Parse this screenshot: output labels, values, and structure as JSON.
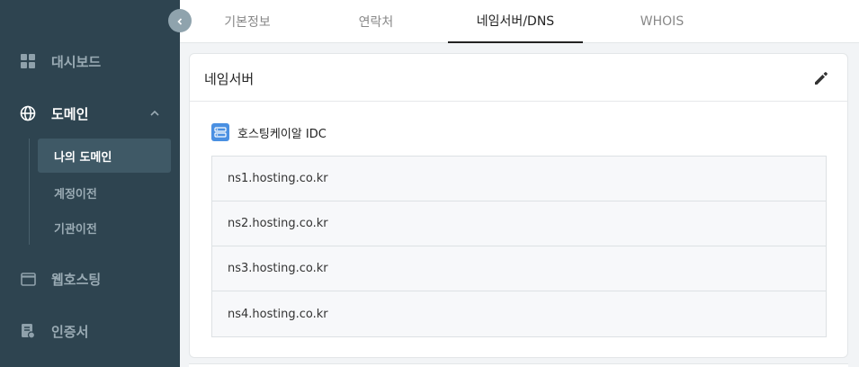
{
  "sidebar": {
    "items": [
      {
        "label": "대시보드",
        "icon": "grid-icon"
      },
      {
        "label": "도메인",
        "icon": "globe-icon",
        "expanded": true
      },
      {
        "label": "웹호스팅",
        "icon": "window-icon"
      },
      {
        "label": "인증서",
        "icon": "certificate-icon"
      }
    ],
    "domain_sub": [
      {
        "label": "나의 도메인",
        "selected": true
      },
      {
        "label": "계정이전"
      },
      {
        "label": "기관이전"
      }
    ]
  },
  "tabs": [
    {
      "label": "기본정보"
    },
    {
      "label": "연락처"
    },
    {
      "label": "네임서버/DNS",
      "active": true
    },
    {
      "label": "WHOIS"
    }
  ],
  "card": {
    "title": "네임서버",
    "provider": "호스팅케이알 IDC",
    "nameservers": [
      "ns1.hosting.co.kr",
      "ns2.hosting.co.kr",
      "ns3.hosting.co.kr",
      "ns4.hosting.co.kr"
    ]
  },
  "colors": {
    "sidebar_bg": "#2e4450",
    "provider_icon": "#4a90e2"
  }
}
